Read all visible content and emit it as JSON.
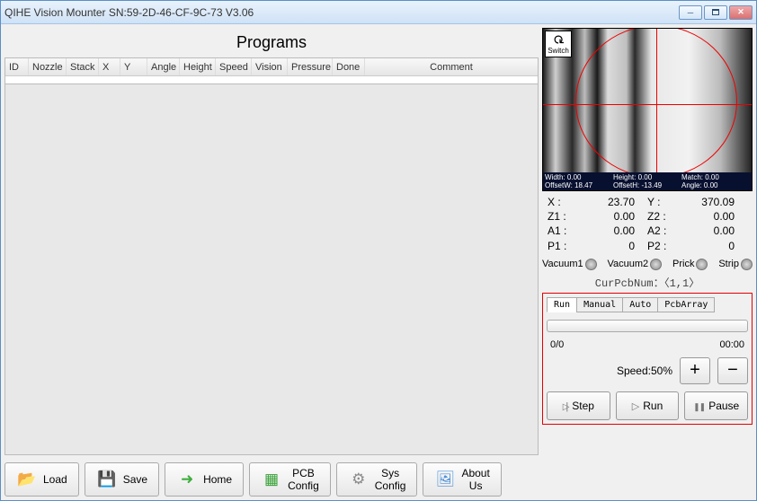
{
  "window": {
    "title": "QIHE Vision Mounter    SN:59-2D-46-CF-9C-73   V3.06"
  },
  "programs": {
    "heading": "Programs",
    "headers": [
      "ID",
      "Nozzle",
      "Stack",
      "X",
      "Y",
      "Angle",
      "Height",
      "Speed",
      "Vision",
      "Pressure",
      "Done",
      "Comment"
    ]
  },
  "camera": {
    "switch_label": "Switch",
    "readout": {
      "width_label": "Width:",
      "width_val": "0.00",
      "offsetw_label": "OffsetW:",
      "offsetw_val": "18.47",
      "height_label": "Height:",
      "height_val": "0.00",
      "offseth_label": "OffsetH:",
      "offseth_val": "-13.49",
      "match_label": "Match:",
      "match_val": "0.00",
      "angle_label": "Angle:",
      "angle_val": "0.00"
    }
  },
  "coords": {
    "X": {
      "label": "X :",
      "val": "23.70"
    },
    "Y": {
      "label": "Y :",
      "val": "370.09"
    },
    "Z1": {
      "label": "Z1 :",
      "val": "0.00"
    },
    "Z2": {
      "label": "Z2 :",
      "val": "0.00"
    },
    "A1": {
      "label": "A1 :",
      "val": "0.00"
    },
    "A2": {
      "label": "A2 :",
      "val": "0.00"
    },
    "P1": {
      "label": "P1 :",
      "val": "0"
    },
    "P2": {
      "label": "P2 :",
      "val": "0"
    }
  },
  "io": {
    "vacuum1": "Vacuum1",
    "vacuum2": "Vacuum2",
    "prick": "Prick",
    "strip": "Strip"
  },
  "curpcb": "CurPcbNum：〈1,1〉",
  "run": {
    "tabs": {
      "run": "Run",
      "manual": "Manual",
      "auto": "Auto",
      "pcbarray": "PcbArray"
    },
    "progress_count": "0/0",
    "progress_time": "00:00",
    "speed_label": "Speed:50%",
    "plus": "+",
    "minus": "−",
    "step": "Step",
    "runbtn": "Run",
    "pause": "Pause"
  },
  "bottom": {
    "load": "Load",
    "save": "Save",
    "home": "Home",
    "pcbconfig": "PCB\nConfig",
    "sysconfig": "Sys\nConfig",
    "about": "About\nUs"
  }
}
